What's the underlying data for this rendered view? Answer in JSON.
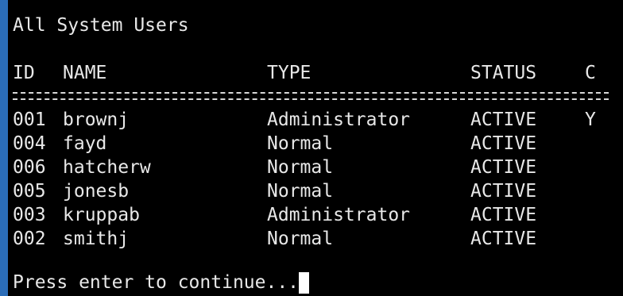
{
  "terminal": {
    "title": "All System Users",
    "columns": {
      "id": "ID",
      "name": "NAME",
      "type": "TYPE",
      "status": "STATUS",
      "c": "C"
    },
    "rows": [
      {
        "id": "001",
        "name": "brownj",
        "type": "Administrator",
        "status": "ACTIVE",
        "c": "Y"
      },
      {
        "id": "004",
        "name": "fayd",
        "type": "Normal",
        "status": "ACTIVE",
        "c": ""
      },
      {
        "id": "006",
        "name": "hatcherw",
        "type": "Normal",
        "status": "ACTIVE",
        "c": ""
      },
      {
        "id": "005",
        "name": "jonesb",
        "type": "Normal",
        "status": "ACTIVE",
        "c": ""
      },
      {
        "id": "003",
        "name": "kruppab",
        "type": "Administrator",
        "status": "ACTIVE",
        "c": ""
      },
      {
        "id": "002",
        "name": "smithj",
        "type": "Normal",
        "status": "ACTIVE",
        "c": ""
      }
    ],
    "prompt": "Press enter to continue..."
  },
  "colors": {
    "background": "#000000",
    "text": "#e8e8e8",
    "accent_bar": "#2b6db8"
  }
}
